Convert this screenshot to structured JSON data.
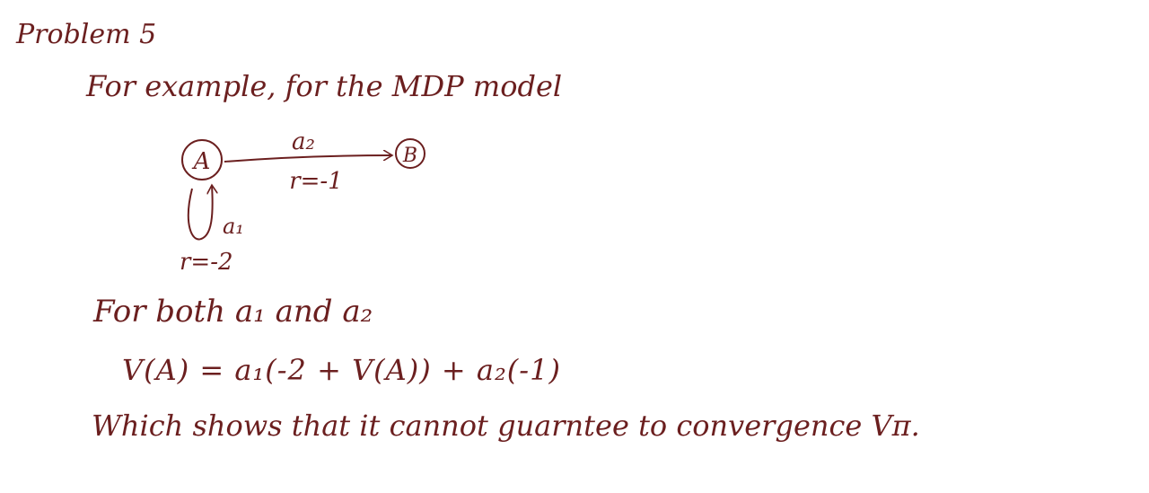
{
  "colors": {
    "ink": "#6b1f1f",
    "background": "#ffffff"
  },
  "heading": "Problem 5",
  "intro": "For example, for the MDP model",
  "diagram": {
    "state_a": "A",
    "state_b": "B",
    "action_transition": "a₂",
    "reward_transition": "r=-1",
    "action_self_loop": "a₁",
    "reward_self_loop": "r=-2"
  },
  "both_line": "For both a₁ and a₂",
  "equation": "V(A) = a₁(-2 + V(A)) + a₂(-1)",
  "conclusion": "Which shows that it cannot guarntee to convergence Vπ."
}
